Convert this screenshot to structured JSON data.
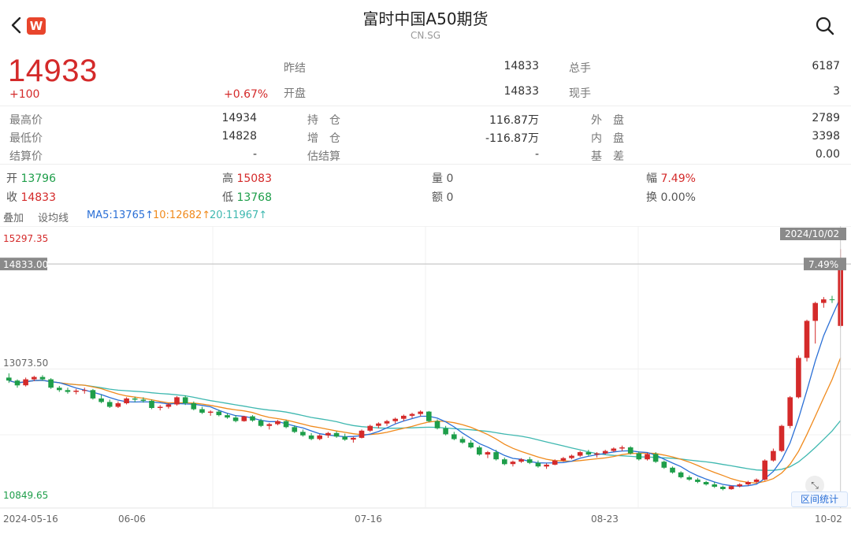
{
  "header": {
    "back_icon": "chevron-left-icon",
    "logo_text": "W",
    "title": "富时中国A50期货",
    "code": "CN.SG",
    "search_icon": "search-icon"
  },
  "quote": {
    "price": "14933",
    "change": "+100",
    "change_pct": "+0.67%",
    "prev_settle_label": "昨结",
    "prev_settle": "14833",
    "open_label": "开盘",
    "open": "14833",
    "total_vol_label": "总手",
    "total_vol": "6187",
    "current_vol_label": "现手",
    "current_vol": "3"
  },
  "stats": {
    "high_label": "最高价",
    "high": "14934",
    "low_label": "最低价",
    "low": "14828",
    "settle_label": "结算价",
    "settle": "-",
    "oi_label": "持　仓",
    "oi": "116.87万",
    "oi_chg_label": "增　仓",
    "oi_chg": "-116.87万",
    "est_settle_label": "估结算",
    "est_settle": "-",
    "outer_label": "外　盘",
    "outer": "2789",
    "inner_label": "内　盘",
    "inner": "3398",
    "basis_label": "基　差",
    "basis": "0.00"
  },
  "ohlc": {
    "open_label": "开",
    "open": "13796",
    "close_label": "收",
    "close": "14833",
    "high_label": "高",
    "high": "15083",
    "low_label": "低",
    "low": "13768",
    "vol_label": "量",
    "vol": "0",
    "amt_label": "额",
    "amt": "0",
    "amp_label": "幅",
    "amp": "7.49%",
    "turn_label": "换",
    "turn": "0.00%"
  },
  "tabs": {
    "overlay": "叠加",
    "set_ma": "设均线"
  },
  "ma": {
    "ma5": "MA5:13765↑",
    "ma10": "10:12682↑",
    "ma20": "20:11967↑"
  },
  "colors": {
    "up": "#d42a2a",
    "down": "#1e9e4a",
    "ma5": "#2a6fd6",
    "ma10": "#f08a1c",
    "ma20": "#3fb8b0"
  },
  "chart_data": {
    "type": "candlestick",
    "y_top_label": "15297.35",
    "y_mid_label": "13073.50",
    "y_bot_label": "10849.65",
    "ylim": [
      10849.65,
      15297.35
    ],
    "crosshair_price": "14833.00",
    "crosshair_date": "2024/10/02",
    "crosshair_pct": "7.49%",
    "x_labels": [
      "2024-05-16",
      "06-06",
      "07-16",
      "08-23",
      "10-02"
    ],
    "range_button": "区间统计",
    "ohlc": [
      [
        12930,
        13000,
        12840,
        12880
      ],
      [
        12880,
        12900,
        12760,
        12800
      ],
      [
        12800,
        12930,
        12780,
        12900
      ],
      [
        12900,
        12960,
        12870,
        12940
      ],
      [
        12940,
        12970,
        12880,
        12900
      ],
      [
        12900,
        12920,
        12740,
        12760
      ],
      [
        12760,
        12790,
        12690,
        12720
      ],
      [
        12720,
        12760,
        12660,
        12690
      ],
      [
        12690,
        12740,
        12650,
        12710
      ],
      [
        12710,
        12760,
        12660,
        12720
      ],
      [
        12720,
        12740,
        12560,
        12580
      ],
      [
        12580,
        12640,
        12500,
        12520
      ],
      [
        12520,
        12560,
        12420,
        12440
      ],
      [
        12440,
        12530,
        12420,
        12500
      ],
      [
        12500,
        12600,
        12480,
        12580
      ],
      [
        12580,
        12610,
        12520,
        12560
      ],
      [
        12560,
        12600,
        12510,
        12540
      ],
      [
        12540,
        12560,
        12400,
        12420
      ],
      [
        12420,
        12470,
        12380,
        12440
      ],
      [
        12440,
        12500,
        12410,
        12480
      ],
      [
        12480,
        12620,
        12460,
        12600
      ],
      [
        12600,
        12630,
        12470,
        12500
      ],
      [
        12500,
        12530,
        12380,
        12400
      ],
      [
        12400,
        12440,
        12320,
        12340
      ],
      [
        12340,
        12380,
        12290,
        12360
      ],
      [
        12360,
        12390,
        12280,
        12300
      ],
      [
        12300,
        12330,
        12240,
        12260
      ],
      [
        12260,
        12300,
        12180,
        12200
      ],
      [
        12200,
        12290,
        12190,
        12280
      ],
      [
        12280,
        12300,
        12190,
        12210
      ],
      [
        12210,
        12240,
        12100,
        12120
      ],
      [
        12120,
        12170,
        12060,
        12150
      ],
      [
        12150,
        12220,
        12130,
        12200
      ],
      [
        12200,
        12220,
        12080,
        12100
      ],
      [
        12100,
        12130,
        12000,
        12020
      ],
      [
        12020,
        12060,
        11940,
        11960
      ],
      [
        11960,
        12000,
        11880,
        11900
      ],
      [
        11900,
        11980,
        11880,
        11960
      ],
      [
        11960,
        12020,
        11920,
        12000
      ],
      [
        12000,
        12030,
        11920,
        11940
      ],
      [
        11940,
        11990,
        11870,
        11890
      ],
      [
        11890,
        11940,
        11840,
        11920
      ],
      [
        11920,
        12060,
        11910,
        12040
      ],
      [
        12040,
        12140,
        12020,
        12120
      ],
      [
        12120,
        12180,
        12080,
        12160
      ],
      [
        12160,
        12220,
        12120,
        12200
      ],
      [
        12200,
        12260,
        12160,
        12240
      ],
      [
        12240,
        12310,
        12200,
        12290
      ],
      [
        12290,
        12340,
        12250,
        12320
      ],
      [
        12320,
        12380,
        12280,
        12360
      ],
      [
        12360,
        12370,
        12180,
        12200
      ],
      [
        12200,
        12230,
        12060,
        12080
      ],
      [
        12080,
        12120,
        11960,
        11980
      ],
      [
        11980,
        12020,
        11880,
        11900
      ],
      [
        11900,
        11940,
        11820,
        11840
      ],
      [
        11840,
        11880,
        11740,
        11760
      ],
      [
        11760,
        11790,
        11620,
        11640
      ],
      [
        11640,
        11700,
        11580,
        11680
      ],
      [
        11680,
        11720,
        11540,
        11560
      ],
      [
        11560,
        11590,
        11460,
        11480
      ],
      [
        11480,
        11540,
        11440,
        11520
      ],
      [
        11520,
        11580,
        11500,
        11560
      ],
      [
        11560,
        11600,
        11480,
        11500
      ],
      [
        11500,
        11540,
        11420,
        11440
      ],
      [
        11440,
        11490,
        11400,
        11470
      ],
      [
        11470,
        11560,
        11460,
        11540
      ],
      [
        11540,
        11600,
        11520,
        11580
      ],
      [
        11580,
        11640,
        11560,
        11620
      ],
      [
        11620,
        11700,
        11600,
        11680
      ],
      [
        11680,
        11720,
        11620,
        11640
      ],
      [
        11640,
        11680,
        11590,
        11660
      ],
      [
        11660,
        11720,
        11640,
        11700
      ],
      [
        11700,
        11760,
        11680,
        11740
      ],
      [
        11740,
        11790,
        11700,
        11760
      ],
      [
        11760,
        11780,
        11640,
        11660
      ],
      [
        11660,
        11690,
        11540,
        11560
      ],
      [
        11560,
        11670,
        11540,
        11650
      ],
      [
        11650,
        11680,
        11500,
        11520
      ],
      [
        11520,
        11540,
        11400,
        11420
      ],
      [
        11420,
        11440,
        11320,
        11340
      ],
      [
        11340,
        11360,
        11240,
        11260
      ],
      [
        11260,
        11290,
        11200,
        11220
      ],
      [
        11220,
        11250,
        11160,
        11180
      ],
      [
        11180,
        11200,
        11120,
        11140
      ],
      [
        11140,
        11180,
        11080,
        11100
      ],
      [
        11100,
        11120,
        11040,
        11060
      ],
      [
        11060,
        11120,
        11050,
        11110
      ],
      [
        11110,
        11160,
        11090,
        11140
      ],
      [
        11140,
        11200,
        11120,
        11180
      ],
      [
        11180,
        11240,
        11160,
        11220
      ],
      [
        11220,
        11560,
        11200,
        11540
      ],
      [
        11540,
        11740,
        11520,
        11700
      ],
      [
        11700,
        12140,
        11680,
        12120
      ],
      [
        12120,
        12620,
        12080,
        12600
      ],
      [
        12600,
        13300,
        12580,
        13260
      ],
      [
        13260,
        13900,
        13200,
        13880
      ],
      [
        13880,
        14200,
        13500,
        14180
      ],
      [
        14180,
        14280,
        14100,
        14240
      ],
      [
        14240,
        14300,
        14180,
        14230
      ],
      [
        13796,
        15083,
        13768,
        14833
      ]
    ]
  }
}
